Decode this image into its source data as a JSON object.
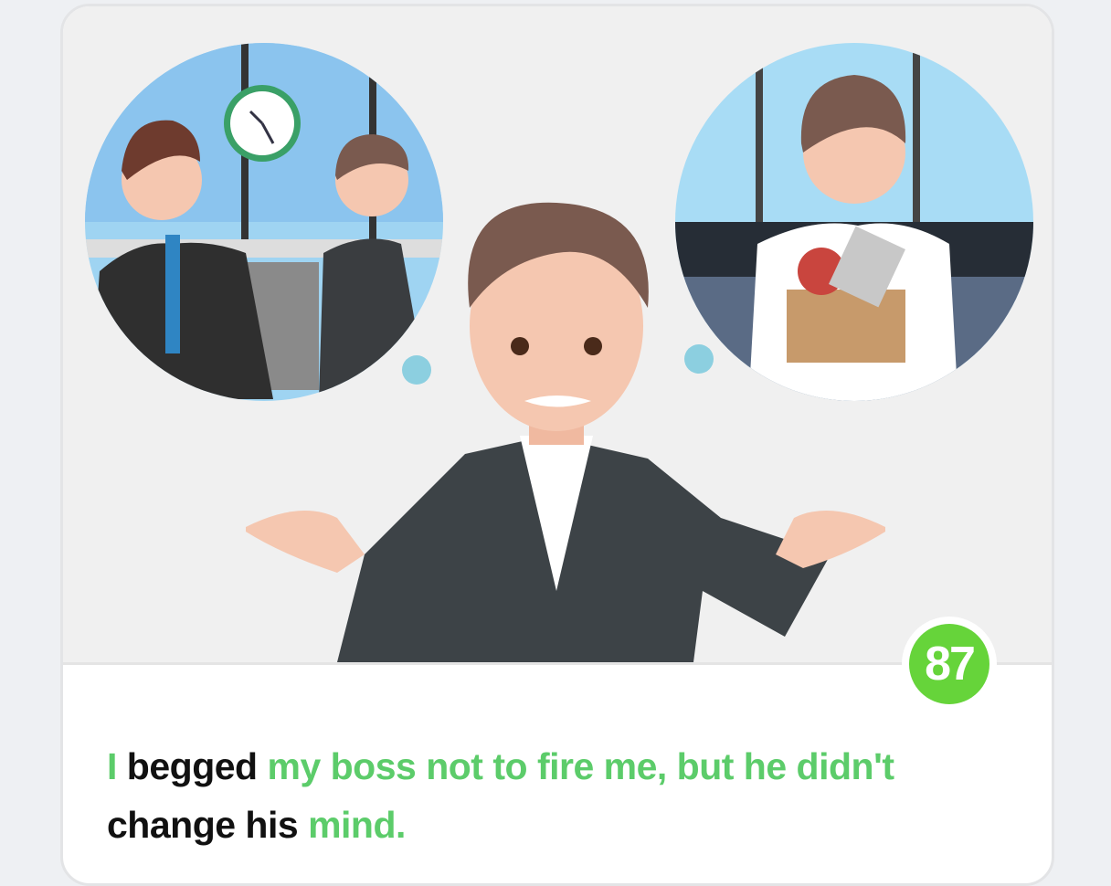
{
  "score": "87",
  "sentence": [
    {
      "text": "I",
      "highlight": true
    },
    {
      "text": " begged ",
      "highlight": false
    },
    {
      "text": "my boss not to fire me, but he didn't",
      "highlight": true
    },
    {
      "text": " change his ",
      "highlight": false
    },
    {
      "text": "mind.",
      "highlight": true
    }
  ],
  "colors": {
    "highlight": "#5ccc6a",
    "score_badge": "#66d43a"
  }
}
